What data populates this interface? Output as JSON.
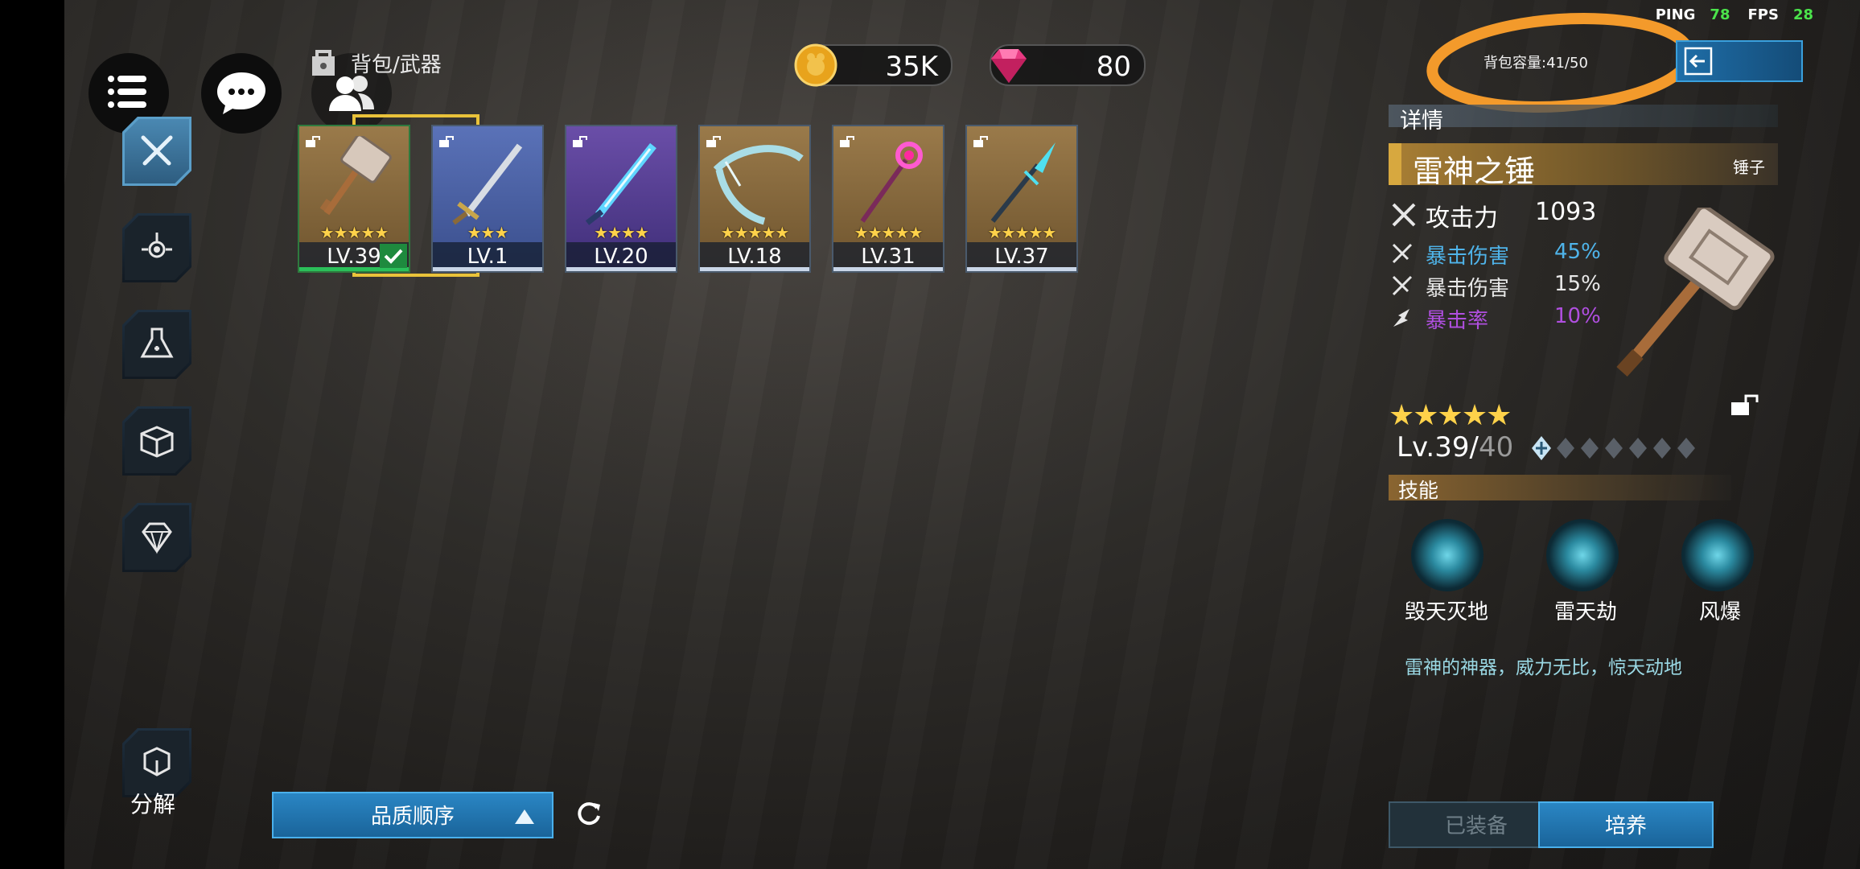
{
  "status": {
    "ping_label": "PING",
    "ping_value": "78",
    "fps_label": "FPS",
    "fps_value": "28"
  },
  "header": {
    "breadcrumb": "背包/武器",
    "coins": "35K",
    "gems": "80",
    "capacity": "背包容量:41/50"
  },
  "weapons": [
    {
      "level": "LV.39",
      "stars": "★★★★★",
      "color": "#8a6a3a",
      "equipped": true
    },
    {
      "level": "LV.1",
      "stars": "★★★",
      "color": "#4a62a8",
      "equipped": false
    },
    {
      "level": "LV.20",
      "stars": "★★★★",
      "color": "#5a3f96",
      "equipped": false
    },
    {
      "level": "LV.18",
      "stars": "★★★★★",
      "color": "#8a6a3a",
      "equipped": false
    },
    {
      "level": "LV.31",
      "stars": "★★★★★",
      "color": "#8a6a3a",
      "equipped": false
    },
    {
      "level": "LV.37",
      "stars": "★★★★★",
      "color": "#8a6a3a",
      "equipped": false
    }
  ],
  "detail": {
    "header": "详情",
    "name": "雷神之锤",
    "type": "锤子",
    "attack_label": "攻击力",
    "attack_value": "1093",
    "stats": [
      {
        "label": "暴击伤害",
        "value": "45%",
        "color": "#4fb4ea"
      },
      {
        "label": "暴击伤害",
        "value": "15%",
        "color": "#e8e8e8"
      },
      {
        "label": "暴击率",
        "value": "10%",
        "color": "#b04fe0"
      }
    ],
    "stars": "★★★★★",
    "level": "Lv.39/",
    "max_level": "40",
    "skills_header": "技能",
    "skills": [
      "毁天灭地",
      "雷天劫",
      "风爆"
    ],
    "description": "雷神的神器，威力无比，惊天动地"
  },
  "sidebar": {
    "decompose_label": "分解"
  },
  "sort": {
    "label": "品质顺序"
  },
  "actions": {
    "equipped_label": "已装备",
    "train_label": "培养"
  }
}
